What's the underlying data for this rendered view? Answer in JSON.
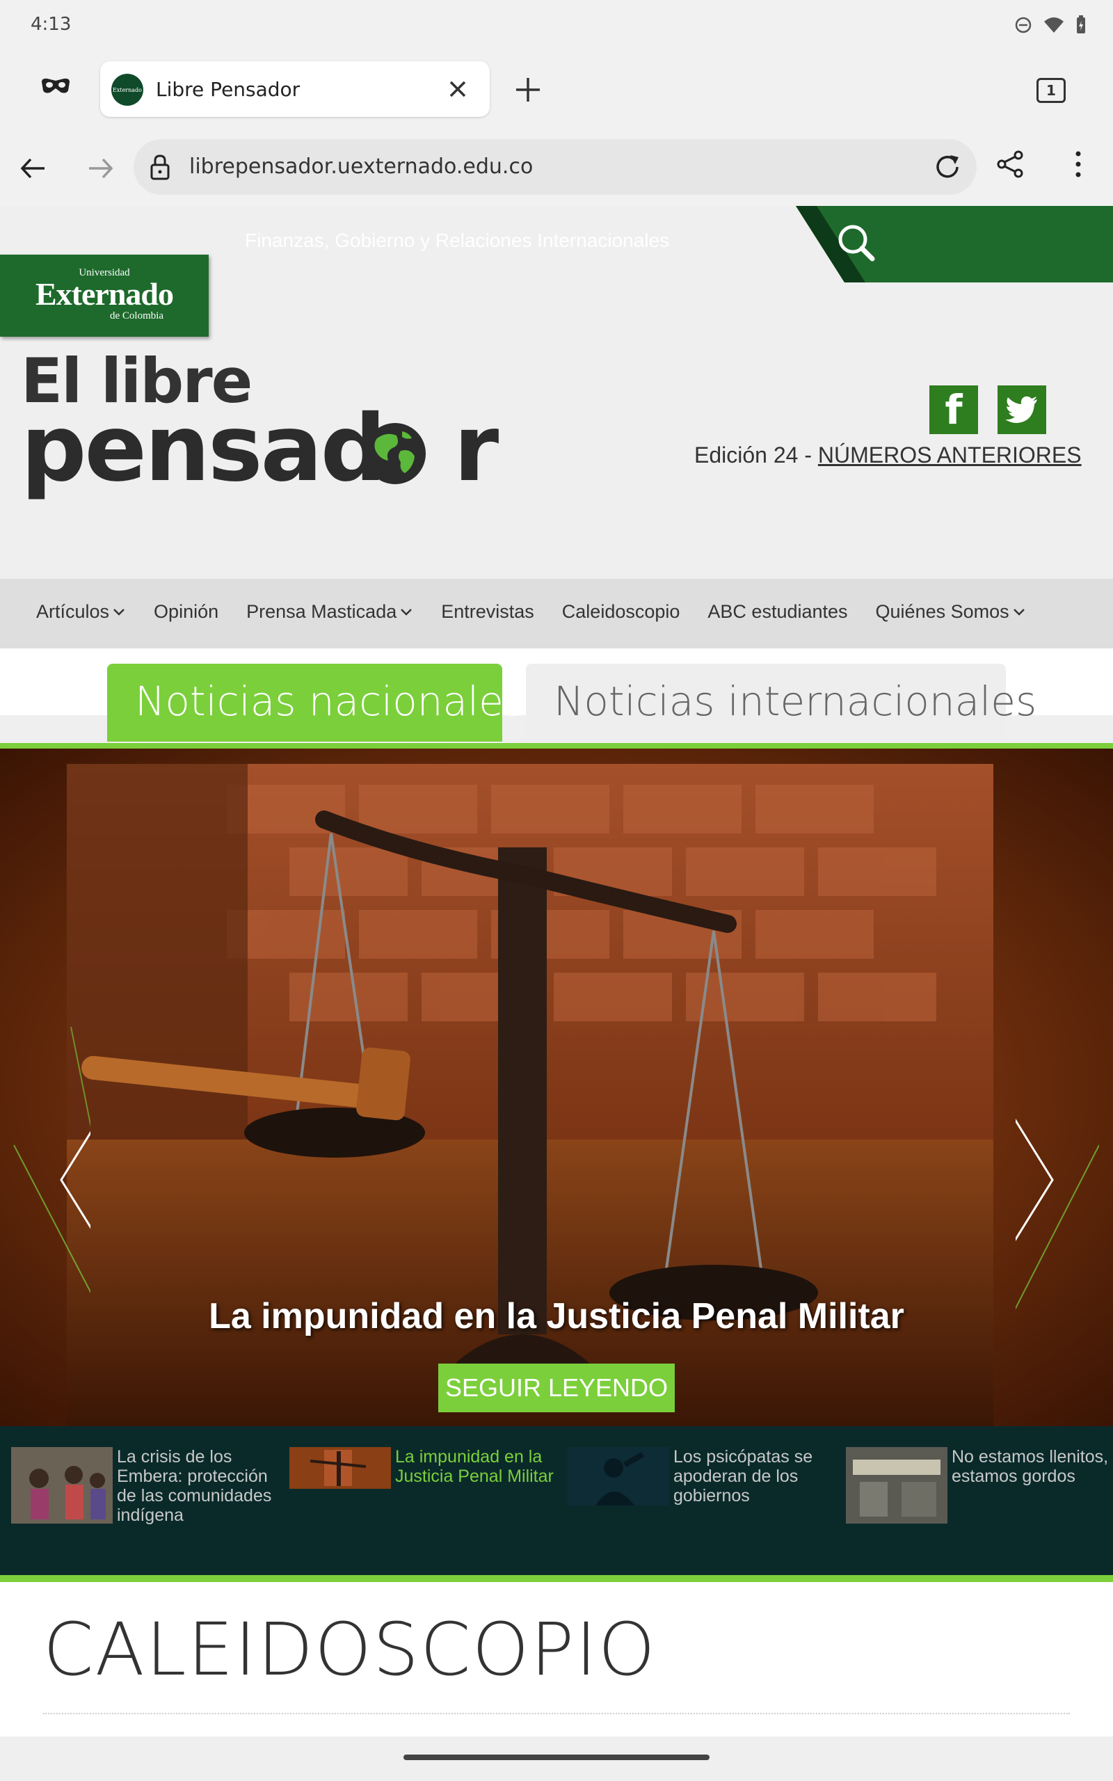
{
  "status_bar": {
    "time": "4:13"
  },
  "browser": {
    "tab_title": "Libre Pensador",
    "favicon_text": "Externado",
    "tab_count": "1",
    "url": "librepensador.uexternado.edu.co"
  },
  "site": {
    "topline": "Finanzas, Gobierno y Relaciones Internacionales",
    "badge": {
      "university": "Universidad",
      "name": "Externado",
      "country": "de Colombia"
    },
    "logo_line1": "El libre",
    "logo_line2": "pensad",
    "logo_line2_tail": "r",
    "social": {
      "facebook": "f"
    },
    "edition_prefix": "Edición 24 - ",
    "edition_link": "NÚMEROS ANTERIORES",
    "nav": [
      {
        "label": "Artículos",
        "dropdown": true
      },
      {
        "label": "Opinión",
        "dropdown": false
      },
      {
        "label": "Prensa Masticada",
        "dropdown": true
      },
      {
        "label": "Entrevistas",
        "dropdown": false
      },
      {
        "label": "Caleidoscopio",
        "dropdown": false
      },
      {
        "label": "ABC estudiantes",
        "dropdown": false
      },
      {
        "label": "Quiénes Somos",
        "dropdown": true
      }
    ],
    "news_tabs": {
      "national": "Noticias nacionales",
      "international": "Noticias internacionales"
    },
    "slider": {
      "title": "La impunidad en la Justicia Penal Militar",
      "button": "SEGUIR LEYENDO"
    },
    "thumbnails": [
      {
        "text": "La crisis de los Embera: protección de las comunidades indígena",
        "active": false
      },
      {
        "text": "La impunidad en la Justicia Penal Militar",
        "active": true
      },
      {
        "text": "Los psicópatas se apoderan de los gobiernos",
        "active": false
      },
      {
        "text": "No estamos llenitos, estamos gordos",
        "active": false
      }
    ],
    "section_heading": "CALEIDOSCOPIO"
  },
  "colors": {
    "brand_green": "#1e6a2c",
    "accent_green": "#7bcf3b",
    "thumb_bg": "#0a2a2a"
  }
}
